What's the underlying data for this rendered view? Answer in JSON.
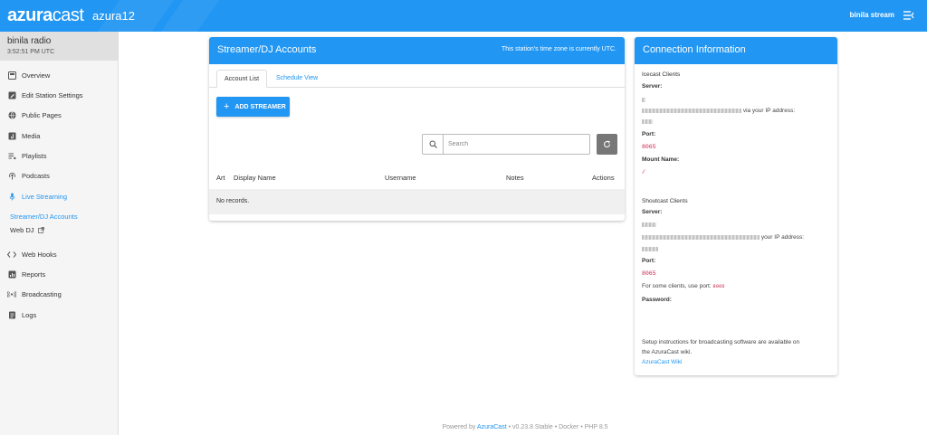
{
  "header": {
    "brand_bold": "azura",
    "brand_light": "cast",
    "station_code": "azura12",
    "user": "binila stream"
  },
  "sidebar": {
    "station_name": "binila radio",
    "station_time": "3:52:51 PM UTC",
    "items": [
      {
        "label": "Overview",
        "icon": "overview-icon"
      },
      {
        "label": "Edit Station Settings",
        "icon": "edit-icon"
      },
      {
        "label": "Public Pages",
        "icon": "globe-icon"
      },
      {
        "label": "Media",
        "icon": "media-icon"
      },
      {
        "label": "Playlists",
        "icon": "playlist-icon"
      },
      {
        "label": "Podcasts",
        "icon": "podcast-icon"
      },
      {
        "label": "Live Streaming",
        "icon": "microphone-icon"
      },
      {
        "label": "Web Hooks",
        "icon": "code-icon"
      },
      {
        "label": "Reports",
        "icon": "reports-icon"
      },
      {
        "label": "Broadcasting",
        "icon": "broadcast-icon"
      },
      {
        "label": "Logs",
        "icon": "logs-icon"
      }
    ],
    "sub_items": [
      {
        "label": "Streamer/DJ Accounts"
      },
      {
        "label": "Web DJ"
      }
    ]
  },
  "streamers": {
    "title": "Streamer/DJ Accounts",
    "timezone_note": "This station's time zone is currently UTC.",
    "tabs": [
      "Account List",
      "Schedule View"
    ],
    "add_button": "ADD STREAMER",
    "search_placeholder": "Search",
    "columns": [
      "Art",
      "Display Name",
      "Username",
      "Notes",
      "Actions"
    ],
    "empty_text": "No records."
  },
  "connection": {
    "title": "Connection Information",
    "icecast": {
      "heading": "Icecast Clients",
      "server_label": "Server:",
      "server_suffix": "via your IP address:",
      "port_label": "Port:",
      "port": "8065",
      "mount_label": "Mount Name:",
      "mount": "/"
    },
    "shoutcast": {
      "heading": "Shoutcast Clients",
      "server_label": "Server:",
      "server_suffix": "your IP address:",
      "port_label": "Port:",
      "port": "8065",
      "other_port_text": "For some clients, use port:",
      "other_port": "8066",
      "password_label": "Password:"
    },
    "setup_text_1": "Setup instructions for broadcasting software are available on",
    "setup_text_2": "the AzuraCast wiki.",
    "wiki_link": "AzuraCast Wiki"
  },
  "footer": {
    "powered_by": "Powered by",
    "link": "AzuraCast",
    "rest": "• v0.23.8 Stable • Docker • PHP 8.5"
  },
  "colors": {
    "primary": "#2196f3",
    "code": "#c7254e"
  }
}
